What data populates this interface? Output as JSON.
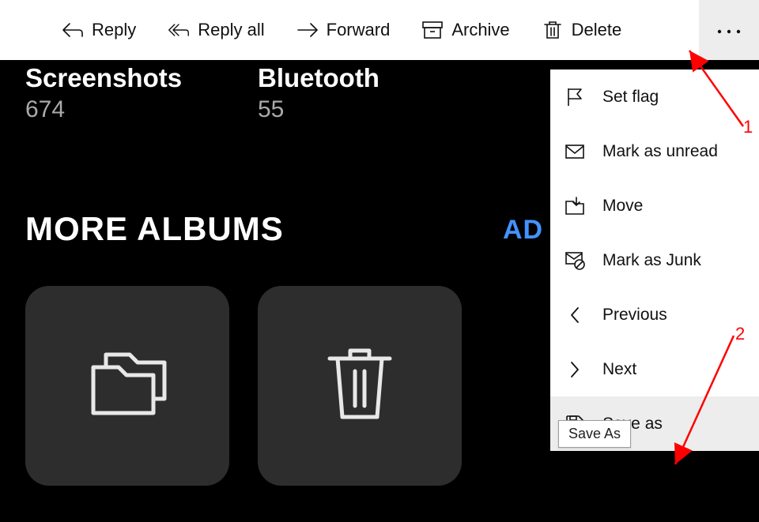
{
  "toolbar": {
    "reply": "Reply",
    "reply_all": "Reply all",
    "forward": "Forward",
    "archive": "Archive",
    "delete": "Delete"
  },
  "gallery": {
    "albums": [
      {
        "title": "Screenshots",
        "count": "674"
      },
      {
        "title": "Bluetooth",
        "count": "55"
      }
    ],
    "more_albums": "MORE ALBUMS",
    "add": "AD"
  },
  "dropdown": {
    "items": [
      {
        "label": "Set flag"
      },
      {
        "label": "Mark as unread"
      },
      {
        "label": "Move"
      },
      {
        "label": "Mark as Junk"
      },
      {
        "label": "Previous"
      },
      {
        "label": "Next"
      },
      {
        "label": "Save as"
      }
    ]
  },
  "tooltip": {
    "saveas": "Save As"
  },
  "annotations": {
    "one": "1",
    "two": "2"
  }
}
